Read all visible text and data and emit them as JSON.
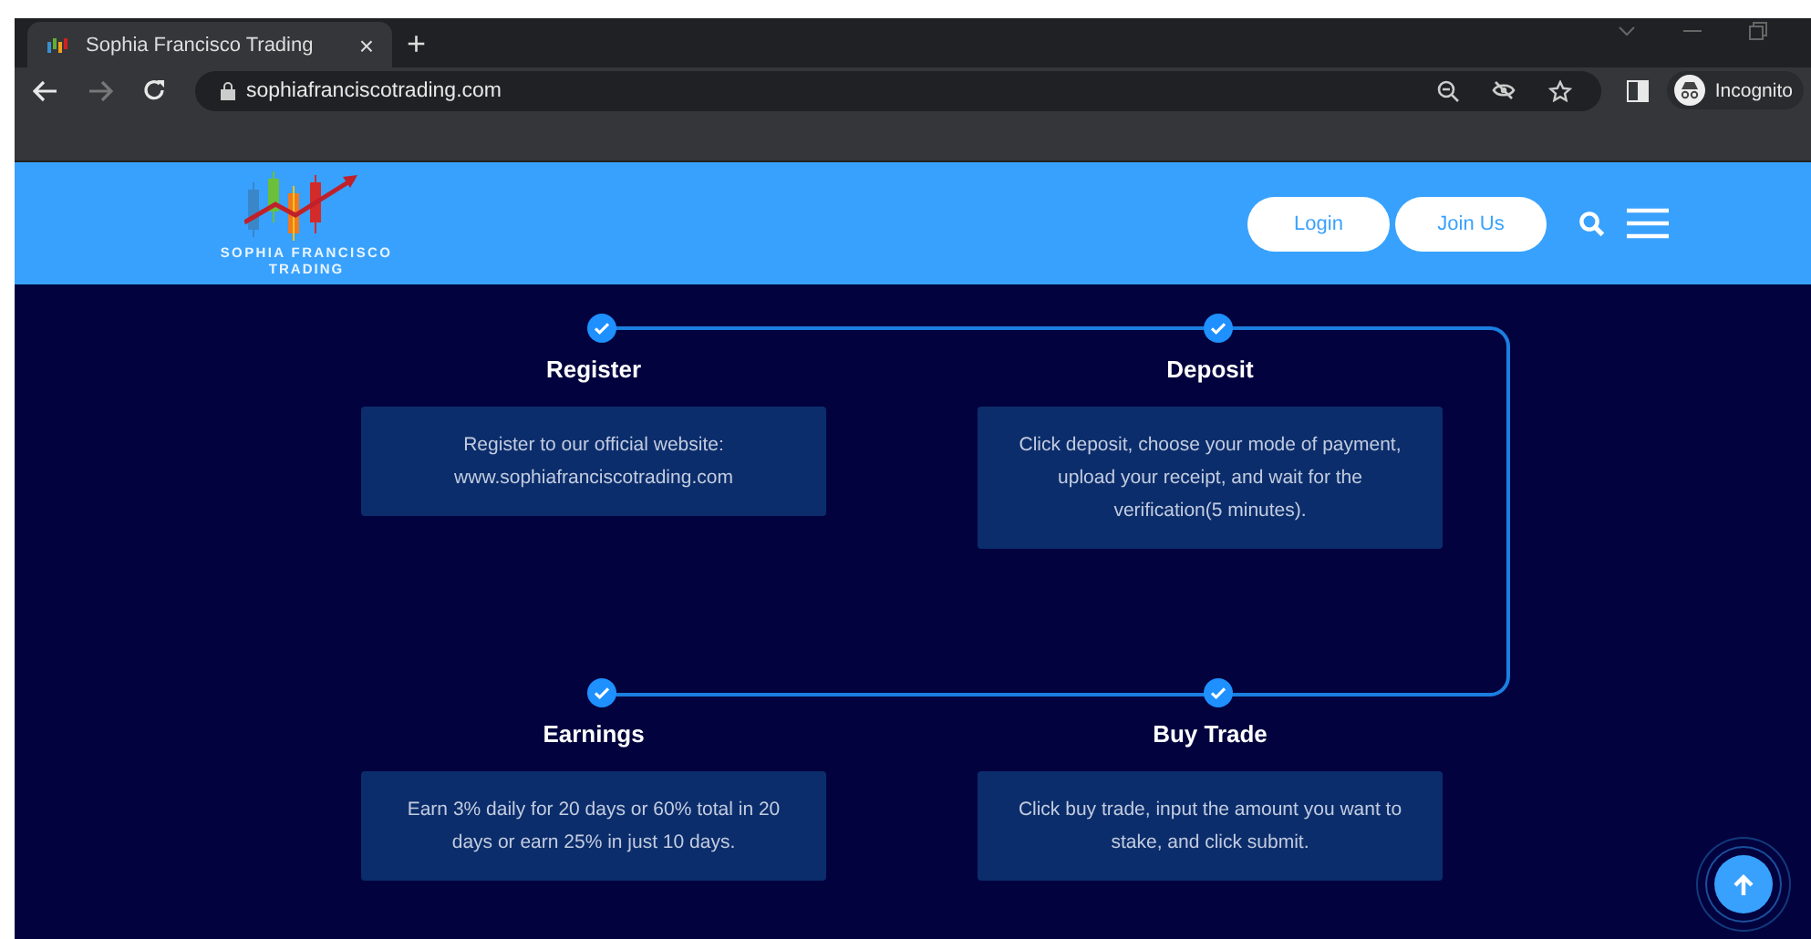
{
  "browser": {
    "tab": {
      "title": "Sophia Francisco Trading",
      "close": "×",
      "selected": true
    },
    "new_tab": "+",
    "url": "sophiafranciscotrading.com",
    "profile": "Incognito"
  },
  "header": {
    "logo": [
      "SOPHIA FRANCISCO",
      "TRADING"
    ],
    "buttons": [
      "Login",
      "Join Us"
    ]
  },
  "steps": [
    {
      "title": "Register",
      "text": "Register to our official website: www.sophiafranciscotrading.com",
      "completed": true
    },
    {
      "title": "Deposit",
      "text": "Click deposit, choose your mode of payment, upload your receipt, and wait for the verification(5 minutes).",
      "completed": true
    },
    {
      "title": "Earnings",
      "text": "Earn 3% daily for 20 days or 60% total in 20 days or earn 25% in just 10 days.",
      "completed": true
    },
    {
      "title": "Buy Trade",
      "text": "Click buy trade, input the amount you want to stake, and click submit.",
      "completed": true
    }
  ]
}
